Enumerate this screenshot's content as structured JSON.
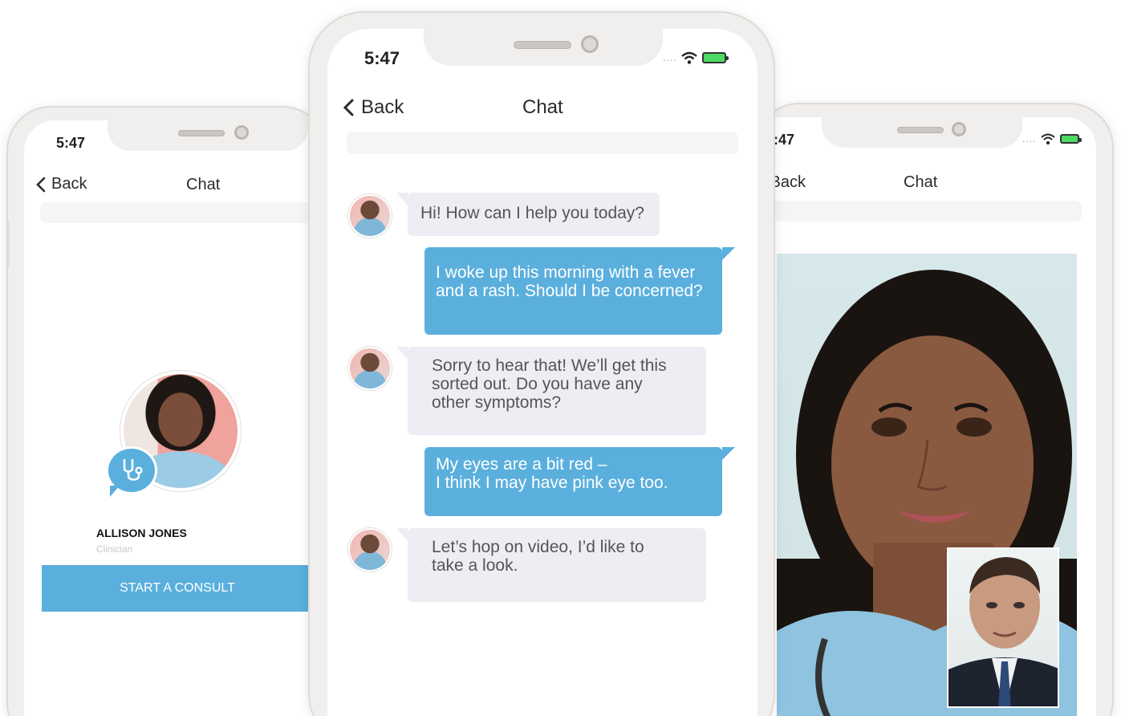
{
  "left_phone": {
    "status_time": "5:47",
    "back_label": "Back",
    "title": "Chat",
    "profile_name": "ALLISON JONES",
    "profile_role": "Clinician",
    "consult_button": "START A CONSULT"
  },
  "center_phone": {
    "status_time": "5:47",
    "status_dots": "....",
    "back_label": "Back",
    "title": "Chat",
    "messages": [
      {
        "from": "clinician",
        "lines": [
          "Hi! How can I help you today?"
        ]
      },
      {
        "from": "patient",
        "lines": [
          "I woke up this morning with a fever",
          "and a rash. Should I be concerned?"
        ]
      },
      {
        "from": "clinician",
        "lines": [
          "Sorry to hear that! We’ll get this",
          "sorted out. Do you have any",
          "other symptoms?"
        ]
      },
      {
        "from": "patient",
        "lines": [
          "My eyes are a bit red –",
          "I think I may have pink eye too."
        ]
      },
      {
        "from": "clinician",
        "lines": [
          "Let’s hop on video, I’d like to",
          "take a look."
        ]
      }
    ]
  },
  "right_phone": {
    "status_time": "5:47",
    "status_dots": "....",
    "back_label": "Back",
    "title": "Chat"
  },
  "colors": {
    "accent": "#5aafdd",
    "incoming_bubble": "#eceef3",
    "frame": "#f1efed"
  },
  "icons": {
    "back": "chevron-left-icon",
    "wifi": "wifi-icon",
    "battery": "battery-charging-icon",
    "consult": "stethoscope-icon"
  }
}
